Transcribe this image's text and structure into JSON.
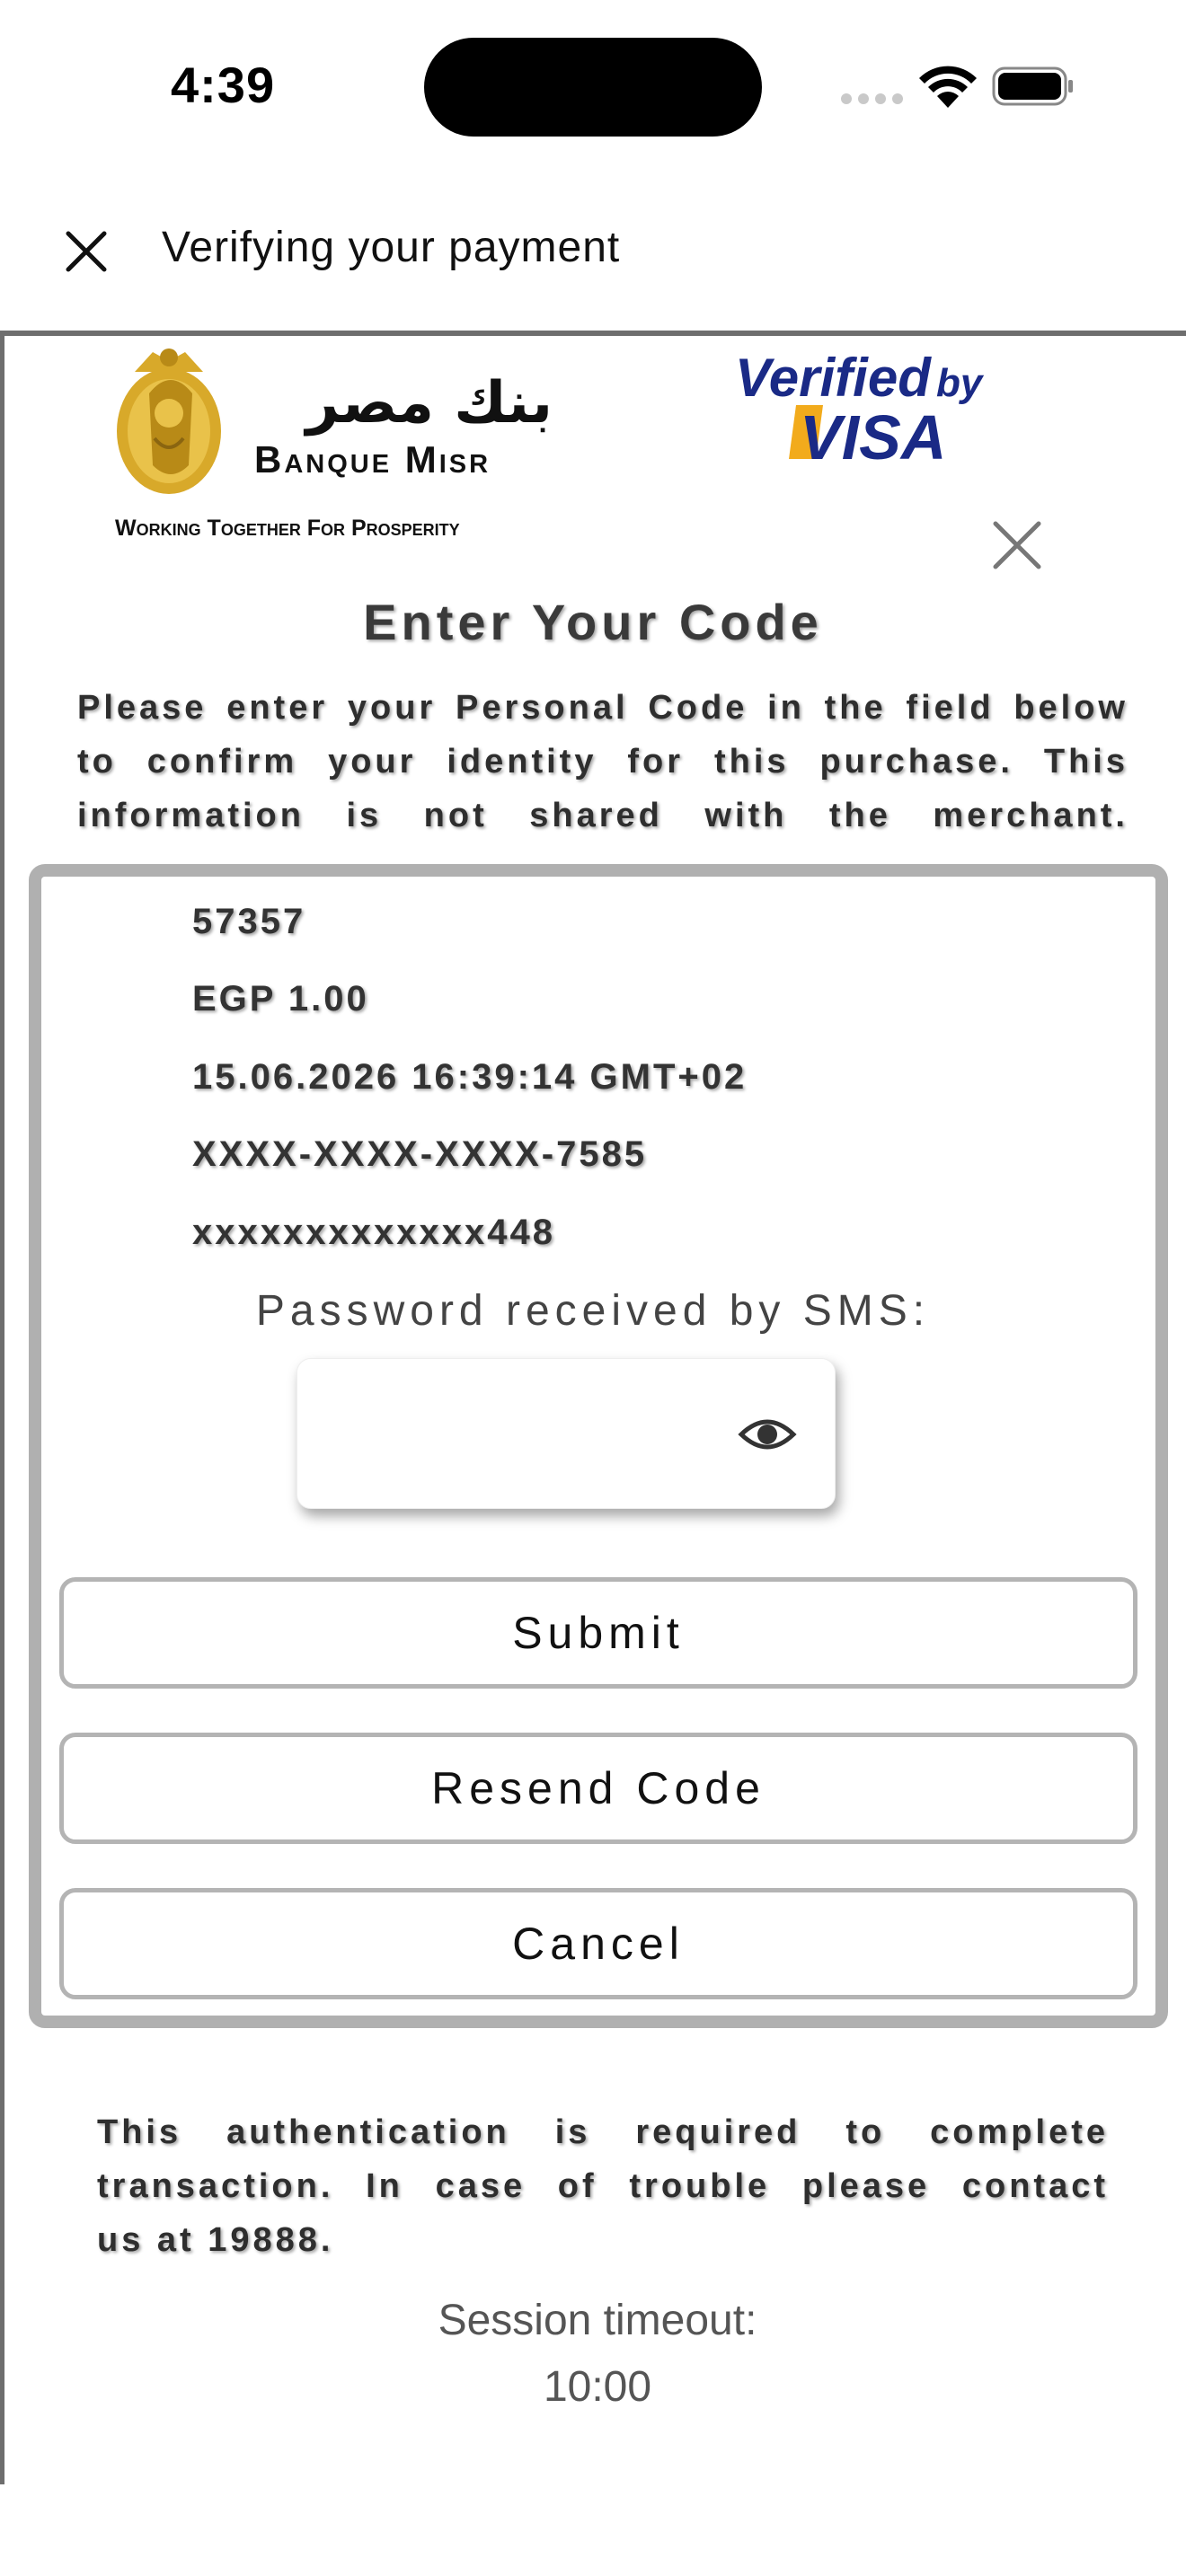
{
  "status_bar": {
    "time": "4:39"
  },
  "nav": {
    "close_icon": "close-icon",
    "title": "Verifying your payment"
  },
  "header": {
    "bank_logo": {
      "arabic_name": "بنك مصر",
      "name": "Banque Misr",
      "tagline": "Working Together For Prosperity",
      "gold": "#d8a92a"
    },
    "visa_logo": {
      "line1": "Verified",
      "line1_suffix": "by",
      "line2": "VISA",
      "blue": "#1a2a86",
      "gold": "#f2ab1c"
    },
    "close_icon": "close-icon"
  },
  "content": {
    "heading": "Enter Your Code",
    "intro": "Please enter your Personal Code in the field below to confirm your identity for this purchase. This information is not shared with the merchant."
  },
  "transaction": {
    "merchant_id": "57357",
    "amount": "EGP 1.00",
    "datetime": "15.06.2026 16:39:14 GMT+02",
    "card_number": "XXXX-XXXX-XXXX-7585",
    "phone": "xxxxxxxxxxxxx448"
  },
  "password": {
    "label": "Password received by SMS:",
    "value": "",
    "icon": "eye-icon"
  },
  "buttons": {
    "submit": "Submit",
    "resend": "Resend Code",
    "cancel": "Cancel"
  },
  "footer": {
    "note_line1": "This authentication is required to complete",
    "note_line2": "transaction. In case of trouble please contact",
    "note_line3": "us at 19888.",
    "timeout_label": "Session timeout:",
    "timeout_value": "10:00"
  },
  "colors": {
    "border_gray": "#b0b0b0",
    "divider": "#6e6e6e"
  }
}
